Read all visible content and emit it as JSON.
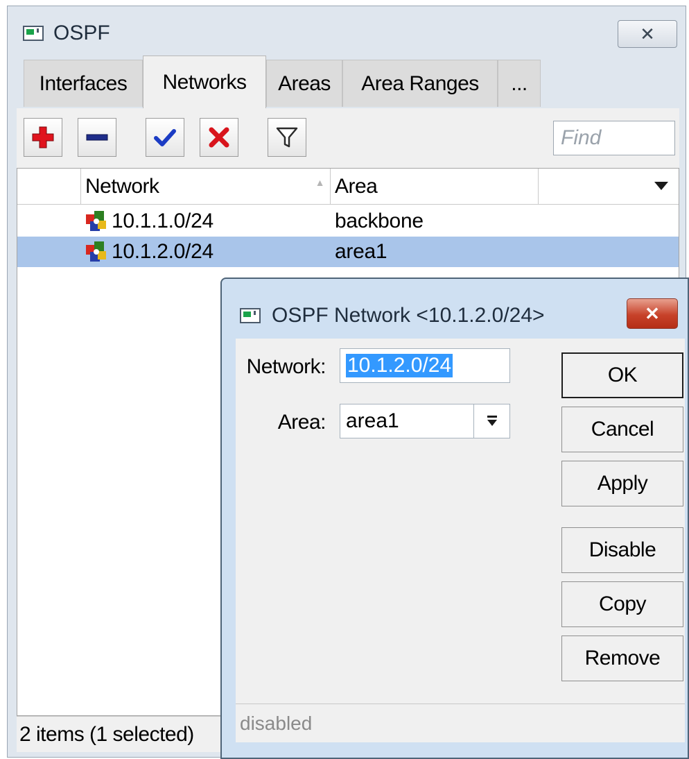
{
  "window": {
    "title": "OSPF",
    "close_glyph": "✕"
  },
  "tabs": [
    {
      "label": "Interfaces",
      "active": false
    },
    {
      "label": "Networks",
      "active": true
    },
    {
      "label": "Areas",
      "active": false
    },
    {
      "label": "Area Ranges",
      "active": false
    },
    {
      "label": "...",
      "active": false
    }
  ],
  "toolbar": {
    "buttons": [
      {
        "name": "add",
        "icon": "plus-icon"
      },
      {
        "name": "remove",
        "icon": "minus-icon"
      },
      {
        "name": "enable",
        "icon": "check-icon"
      },
      {
        "name": "disable",
        "icon": "x-icon"
      },
      {
        "name": "filter",
        "icon": "funnel-icon"
      }
    ],
    "find_placeholder": "Find"
  },
  "table": {
    "columns": [
      "Network",
      "Area"
    ],
    "sort_indicator": "▲",
    "rows": [
      {
        "network": "10.1.1.0/24",
        "area": "backbone",
        "selected": false
      },
      {
        "network": "10.1.2.0/24",
        "area": "area1",
        "selected": true
      }
    ]
  },
  "status": "2 items (1 selected)",
  "dialog": {
    "title": "OSPF Network <10.1.2.0/24>",
    "network_label": "Network:",
    "network_value": "10.1.2.0/24",
    "area_label": "Area:",
    "area_value": "area1",
    "buttons": {
      "ok": "OK",
      "cancel": "Cancel",
      "apply": "Apply",
      "disable": "Disable",
      "copy": "Copy",
      "remove": "Remove"
    },
    "status": "disabled"
  },
  "colors": {
    "selection": "#a9c5ea",
    "add": "#e0141e",
    "remove": "#1f2d8a",
    "check": "#1b3cc4",
    "close_red": "#c7422a"
  }
}
